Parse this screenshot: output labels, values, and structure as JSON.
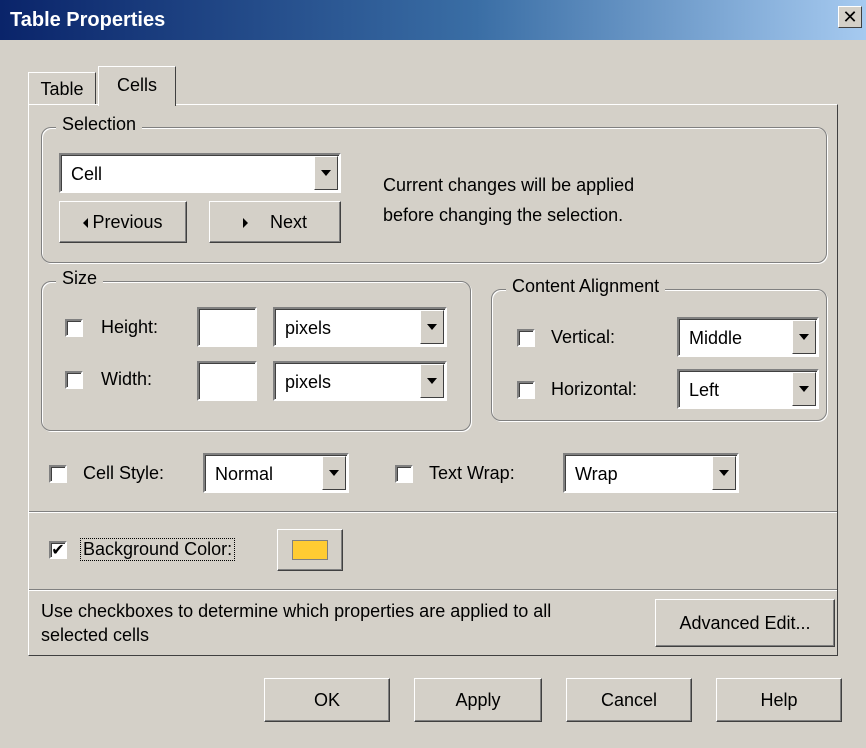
{
  "window": {
    "title": "Table Properties",
    "close_glyph": "✕"
  },
  "tabs": [
    {
      "label": "Table",
      "active": false
    },
    {
      "label": "Cells",
      "active": true
    }
  ],
  "selection": {
    "group_label": "Selection",
    "dropdown_value": "Cell",
    "previous_label": "Previous",
    "next_label": "Next",
    "info_line1": "Current changes will be applied",
    "info_line2": "before changing the selection."
  },
  "size": {
    "group_label": "Size",
    "height": {
      "label": "Height:",
      "checked": false,
      "value": "",
      "unit": "pixels"
    },
    "width": {
      "label": "Width:",
      "checked": false,
      "value": "",
      "unit": "pixels"
    }
  },
  "content_alignment": {
    "group_label": "Content Alignment",
    "vertical": {
      "label": "Vertical:",
      "checked": false,
      "value": "Middle"
    },
    "horizontal": {
      "label": "Horizontal:",
      "checked": false,
      "value": "Left"
    }
  },
  "cell_style": {
    "label": "Cell Style:",
    "checked": false,
    "value": "Normal"
  },
  "text_wrap": {
    "label": "Text Wrap:",
    "checked": false,
    "value": "Wrap"
  },
  "background_color": {
    "label": "Background Color:",
    "checked": true,
    "check_glyph": "✔",
    "color": "#ffcc33"
  },
  "footer": {
    "hint_line1": "Use checkboxes to determine which properties are applied to all",
    "hint_line2": "selected cells",
    "advanced_edit_label": "Advanced Edit..."
  },
  "buttons": {
    "ok": "OK",
    "apply": "Apply",
    "cancel": "Cancel",
    "help": "Help"
  },
  "colors": {
    "titlebar_start": "#0a246a",
    "titlebar_end": "#a6caf0",
    "dialog_bg": "#d4d0c8"
  }
}
